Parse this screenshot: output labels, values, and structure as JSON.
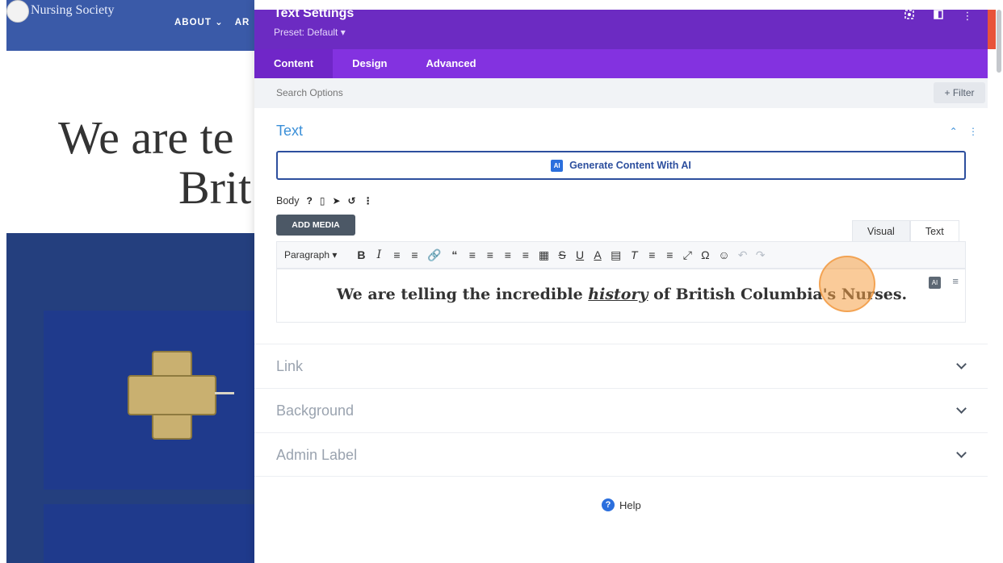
{
  "site": {
    "name": "Nursing Society",
    "nav": [
      "ABOUT ⌄",
      "AR"
    ],
    "heading_line1": "We are te",
    "heading_line2": "Brit"
  },
  "modal": {
    "title": "Text Settings",
    "preset": "Preset: Default ▾",
    "header_icons": [
      "focus-icon",
      "split-view-icon",
      "more-vertical-icon"
    ],
    "tabs": [
      {
        "label": "Content",
        "active": true
      },
      {
        "label": "Design",
        "active": false
      },
      {
        "label": "Advanced",
        "active": false
      }
    ],
    "search_placeholder": "Search Options",
    "filter_label": "+ Filter"
  },
  "text_section": {
    "title": "Text",
    "ai_button_badge": "AI",
    "ai_button_label": "Generate Content With AI",
    "body_label": "Body",
    "add_media_label": "ADD MEDIA",
    "editor_tabs": [
      "Visual",
      "Text"
    ],
    "paragraph_select": "Paragraph",
    "editor_content": {
      "before": "We are telling the incredible ",
      "emphasis": "history",
      "after": " of British Columbia's Nurses."
    },
    "editor_ai_badge": "AI"
  },
  "accordions": [
    {
      "label": "Link"
    },
    {
      "label": "Background"
    },
    {
      "label": "Admin Label"
    }
  ],
  "help_label": "Help",
  "colors": {
    "header": "#6c2bc2",
    "tabs": "#8332e0",
    "accent": "#3a8fd8"
  }
}
